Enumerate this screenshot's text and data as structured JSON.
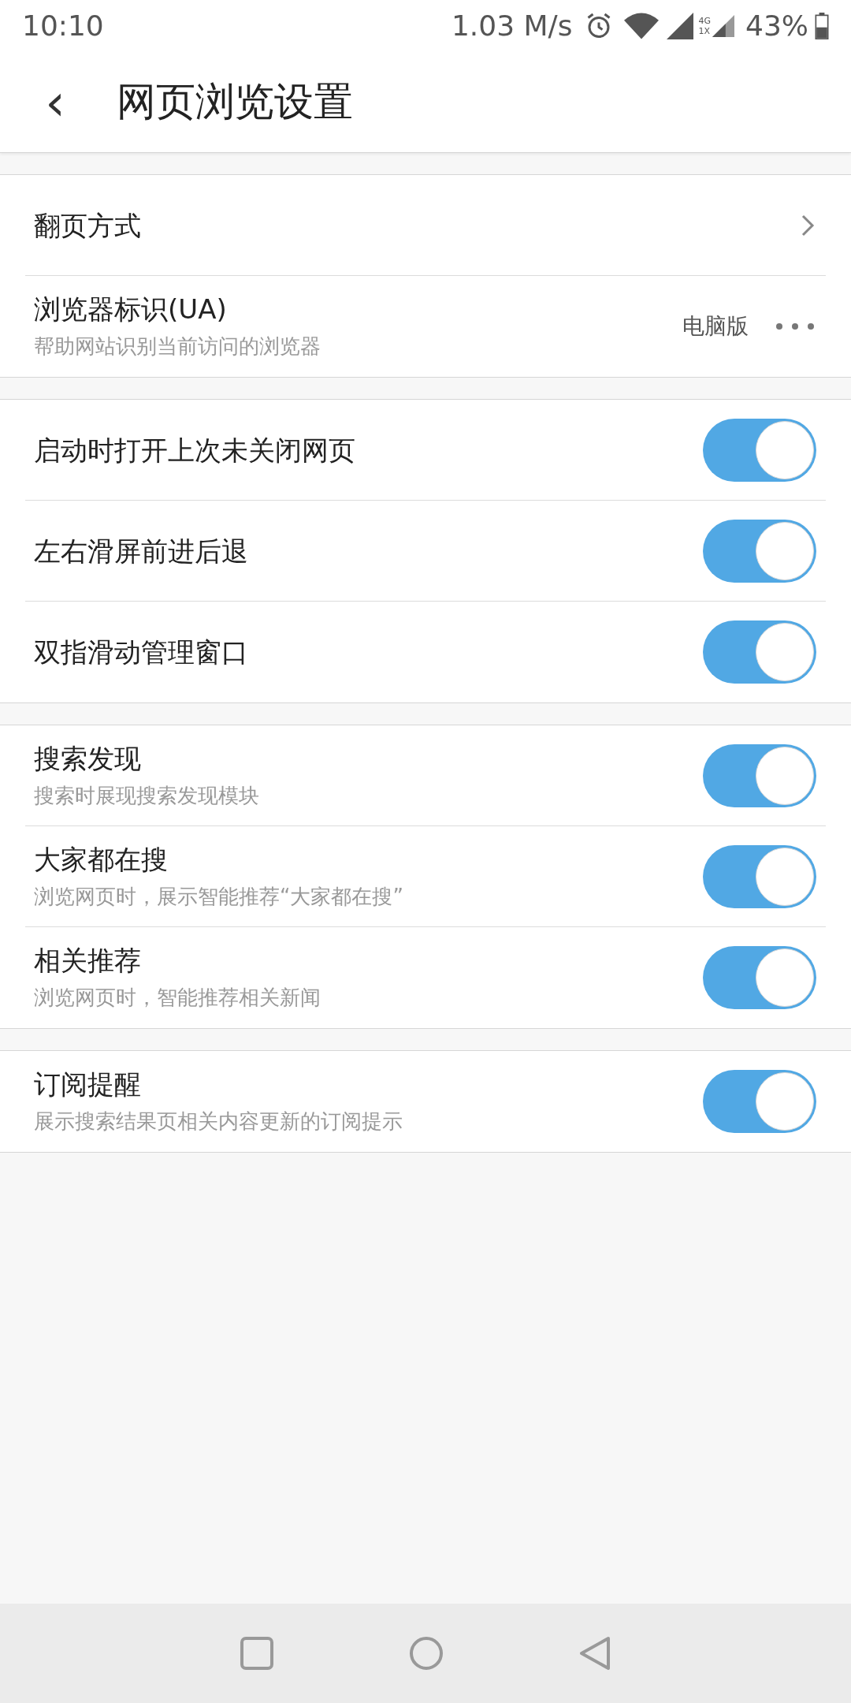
{
  "status_bar": {
    "time": "10:10",
    "speed": "1.03 M/s",
    "network_top": "4G",
    "network_bottom": "1X",
    "battery": "43%"
  },
  "header": {
    "back": "‹",
    "title": "网页浏览设置"
  },
  "sections": [
    {
      "items": [
        {
          "kind": "link",
          "label": "翻页方式"
        },
        {
          "kind": "choice",
          "label": "浏览器标识(UA)",
          "description": "帮助网站识别当前访问的浏览器",
          "value": "电脑版"
        }
      ]
    },
    {
      "items": [
        {
          "kind": "toggle",
          "label": "启动时打开上次未关闭网页",
          "on": true
        },
        {
          "kind": "toggle",
          "label": "左右滑屏前进后退",
          "on": true
        },
        {
          "kind": "toggle",
          "label": "双指滑动管理窗口",
          "on": true
        }
      ]
    },
    {
      "items": [
        {
          "kind": "toggle",
          "label": "搜索发现",
          "description": "搜索时展现搜索发现模块",
          "on": true
        },
        {
          "kind": "toggle",
          "label": "大家都在搜",
          "description": "浏览网页时，展示智能推荐“大家都在搜”",
          "on": true
        },
        {
          "kind": "toggle",
          "label": "相关推荐",
          "description": "浏览网页时，智能推荐相关新闻",
          "on": true
        }
      ]
    },
    {
      "items": [
        {
          "kind": "toggle",
          "label": "订阅提醒",
          "description": "展示搜索结果页相关内容更新的订阅提示",
          "on": true
        }
      ]
    }
  ]
}
